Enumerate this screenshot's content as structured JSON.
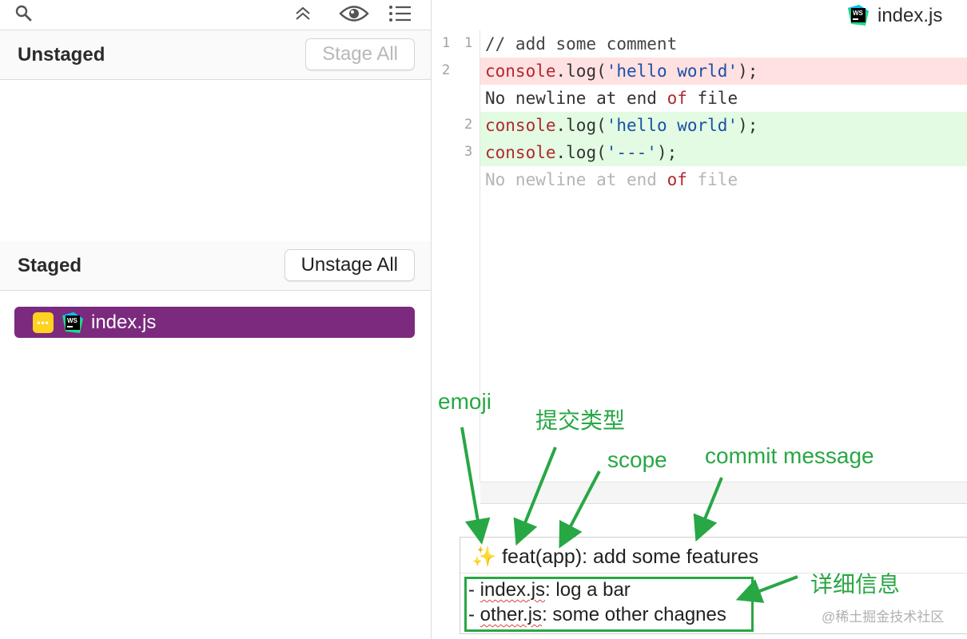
{
  "left": {
    "unstaged": {
      "title": "Unstaged",
      "button": "Stage All"
    },
    "staged": {
      "title": "Staged",
      "button": "Unstage All"
    },
    "staged_files": [
      {
        "name": "index.js",
        "icon": "webstorm-icon"
      }
    ]
  },
  "diff": {
    "filename": "index.js",
    "lines": [
      {
        "old": "1",
        "new": "1",
        "type": "context",
        "tokens": [
          {
            "t": "// add some comment",
            "c": "comment"
          }
        ]
      },
      {
        "old": "2",
        "new": "",
        "type": "removed",
        "tokens": [
          {
            "t": "console",
            "c": "obj"
          },
          {
            "t": ".log(",
            "c": "plain"
          },
          {
            "t": "'hello world'",
            "c": "str"
          },
          {
            "t": ");",
            "c": "plain"
          }
        ]
      },
      {
        "old": "",
        "new": "",
        "type": "context",
        "tokens": [
          {
            "t": "No newline at end ",
            "c": "plain"
          },
          {
            "t": "of",
            "c": "kw"
          },
          {
            "t": " file",
            "c": "plain"
          }
        ]
      },
      {
        "old": "",
        "new": "2",
        "type": "added",
        "tokens": [
          {
            "t": "console",
            "c": "obj"
          },
          {
            "t": ".log(",
            "c": "plain"
          },
          {
            "t": "'hello world'",
            "c": "str"
          },
          {
            "t": ");",
            "c": "plain"
          }
        ]
      },
      {
        "old": "",
        "new": "3",
        "type": "added",
        "tokens": [
          {
            "t": "console",
            "c": "obj"
          },
          {
            "t": ".log(",
            "c": "plain"
          },
          {
            "t": "'---'",
            "c": "str"
          },
          {
            "t": ");",
            "c": "plain"
          }
        ]
      },
      {
        "old": "",
        "new": "",
        "type": "faded",
        "tokens": [
          {
            "t": "No newline at end ",
            "c": "plain"
          },
          {
            "t": "of",
            "c": "kw"
          },
          {
            "t": " file",
            "c": "plain"
          }
        ]
      }
    ]
  },
  "commit": {
    "emoji": "✨",
    "subject": "feat(app): add some features",
    "body": [
      {
        "file": "index.js",
        "rest": ": log a bar"
      },
      {
        "file": "other.js",
        "rest": ": some other chagnes"
      }
    ]
  },
  "annotations": {
    "emoji": "emoji",
    "type": "提交类型",
    "scope": "scope",
    "message": "commit message",
    "details": "详细信息"
  },
  "watermark": "@稀土掘金技术社区",
  "colors": {
    "staged_row": "#7b2a7e",
    "annotation": "#28a745",
    "removed_bg": "#ffe1e1",
    "added_bg": "#e2fbe2"
  }
}
